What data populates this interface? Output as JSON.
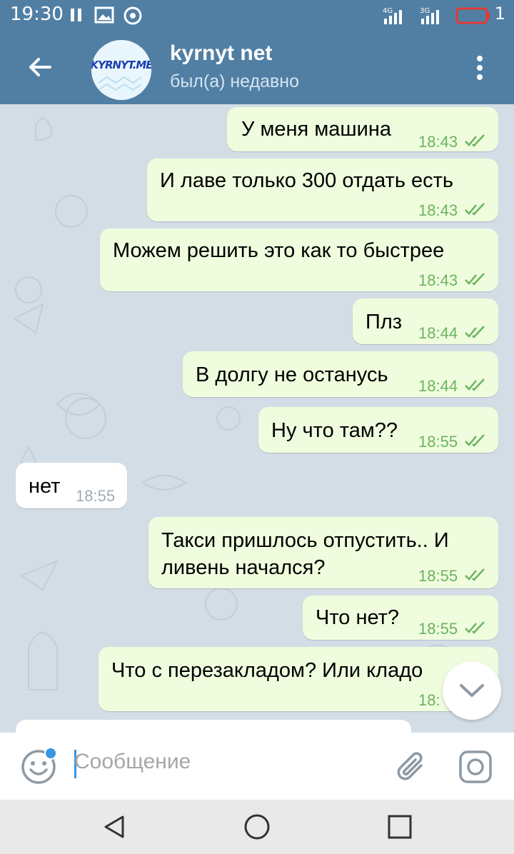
{
  "status_bar": {
    "time": "19:30",
    "battery_level": "1"
  },
  "header": {
    "title": "kyrnyt net",
    "subtitle": "был(а) недавно",
    "avatar_text": "KYRNYT.ME"
  },
  "messages": [
    {
      "dir": "out",
      "text": "У меня машина",
      "time": "18:43",
      "read": true
    },
    {
      "dir": "out",
      "text": "И лаве только 300 отдать есть",
      "time": "18:43",
      "read": true
    },
    {
      "dir": "out",
      "text": "Можем решить это как то быстрее",
      "time": "18:43",
      "read": true
    },
    {
      "dir": "out",
      "text": "Плз",
      "time": "18:44",
      "read": true
    },
    {
      "dir": "out",
      "text": "В долгу не останусь",
      "time": "18:44",
      "read": true
    },
    {
      "dir": "out",
      "text": "Ну что там??",
      "time": "18:55",
      "read": true
    },
    {
      "dir": "in",
      "text": "нет",
      "time": "18:55"
    },
    {
      "dir": "out",
      "text": "Такси пришлось отпустить.. И ливень начался?",
      "line1": "Такси пришлось отпустить.. И",
      "line2": "ливень начался?",
      "time": "18:55",
      "read": true
    },
    {
      "dir": "out",
      "text": "Что нет?",
      "time": "18:55",
      "read": true
    },
    {
      "dir": "out",
      "text": "Что с перезакладом? Или кладо",
      "time": "18:",
      "read": true
    }
  ],
  "input": {
    "placeholder": "Сообщение"
  },
  "colors": {
    "header": "#517fa4",
    "outgoing_bubble": "#effdde",
    "incoming_bubble": "#ffffff",
    "check": "#6cb35e",
    "accent": "#3a96e0"
  },
  "icons": [
    "back-arrow-icon",
    "menu-dots-icon",
    "emoji-icon",
    "attach-clip-icon",
    "camera-icon",
    "chevron-down-icon",
    "nav-back-icon",
    "nav-home-icon",
    "nav-recents-icon"
  ]
}
